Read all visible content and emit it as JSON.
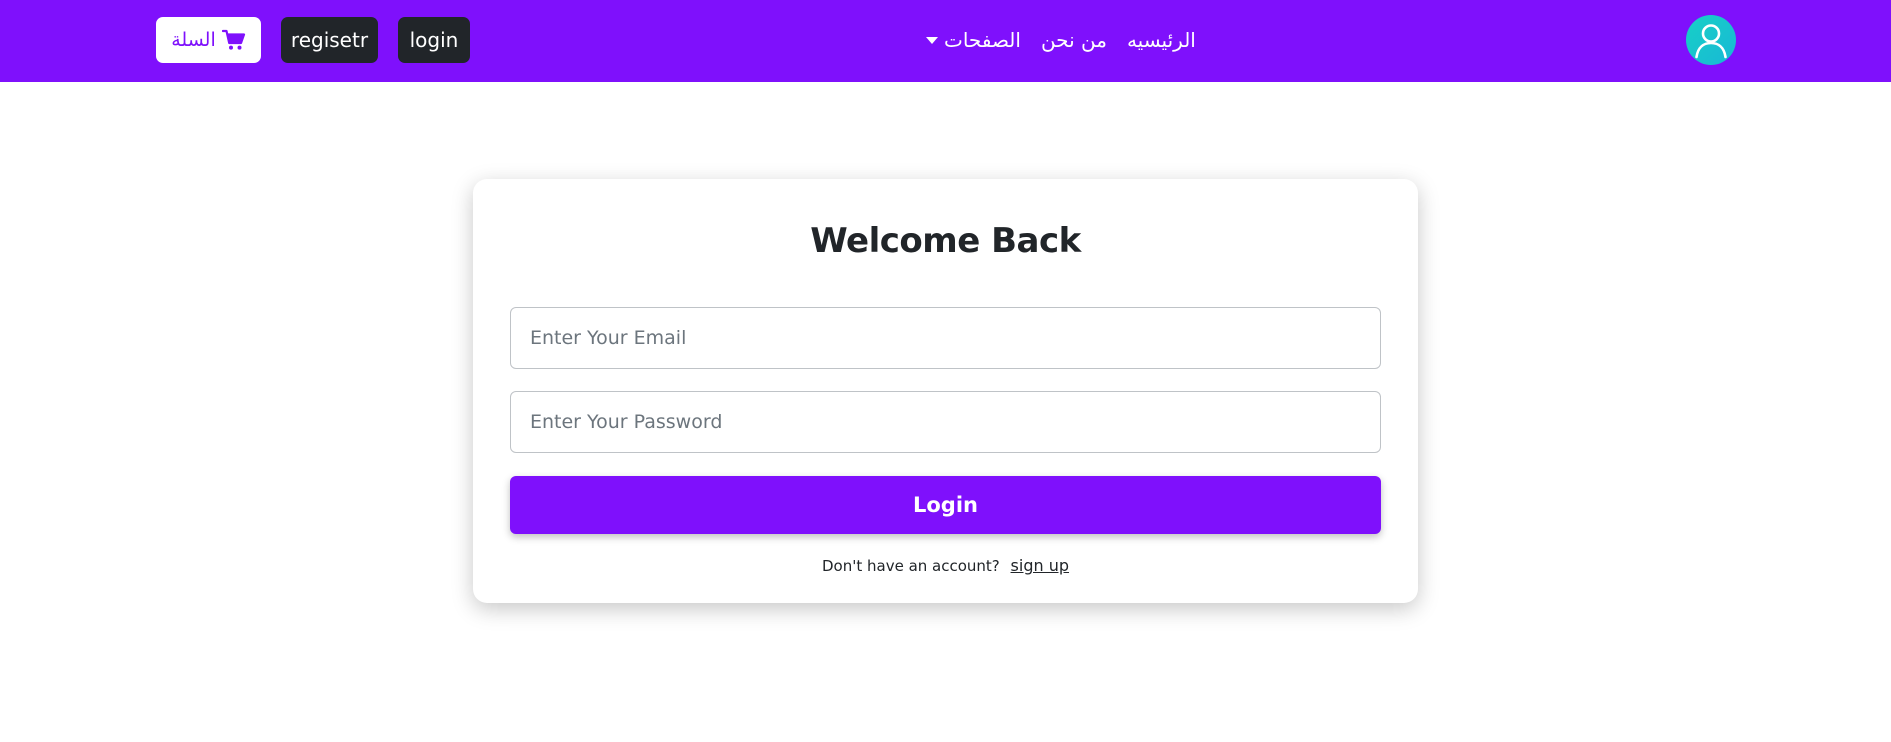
{
  "navbar": {
    "background": "#7f10fc",
    "cart_label": "السلة",
    "cart_icon": "shopping-cart-icon",
    "register_label": "regisetr",
    "login_label": "login",
    "links": {
      "home": "الرئيسيه",
      "about": "من نحن",
      "pages": "الصفحات"
    },
    "avatar_icon": "user-avatar-icon"
  },
  "form": {
    "title": "Welcome Back",
    "email_placeholder": "Enter Your Email",
    "password_placeholder": "Enter Your Password",
    "submit_label": "Login",
    "signup_prompt": "Don't have an account?",
    "signup_link": "sign up",
    "accent": "#7f10fc"
  }
}
